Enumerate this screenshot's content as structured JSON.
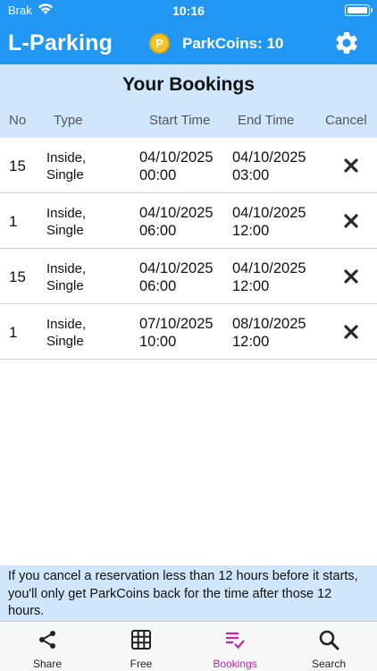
{
  "status_bar": {
    "carrier": "Brak",
    "time": "10:16"
  },
  "app_bar": {
    "title": "L-Parking",
    "coin_symbol": "P",
    "coins_label": "ParkCoins: 10"
  },
  "page": {
    "title": "Your Bookings"
  },
  "table": {
    "headers": {
      "no": "No",
      "type": "Type",
      "start": "Start Time",
      "end": "End Time",
      "cancel": "Cancel"
    },
    "rows": [
      {
        "no": "15",
        "type_line1": "Inside,",
        "type_line2": "Single",
        "start_date": "04/10/2025",
        "start_time": "00:00",
        "end_date": "04/10/2025",
        "end_time": "03:00"
      },
      {
        "no": "1",
        "type_line1": "Inside,",
        "type_line2": "Single",
        "start_date": "04/10/2025",
        "start_time": "06:00",
        "end_date": "04/10/2025",
        "end_time": "12:00"
      },
      {
        "no": "15",
        "type_line1": "Inside,",
        "type_line2": "Single",
        "start_date": "04/10/2025",
        "start_time": "06:00",
        "end_date": "04/10/2025",
        "end_time": "12:00"
      },
      {
        "no": "1",
        "type_line1": "Inside,",
        "type_line2": "Single",
        "start_date": "07/10/2025",
        "start_time": "10:00",
        "end_date": "08/10/2025",
        "end_time": "12:00"
      }
    ]
  },
  "footer_note": "If you cancel a reservation less than 12 hours before it starts, you'll only get ParkCoins back for the time after those 12 hours.",
  "tab_bar": {
    "share": "Share",
    "free": "Free",
    "bookings": "Bookings",
    "search": "Search"
  },
  "colors": {
    "primary": "#2196f3",
    "header_bg": "#cfe6fb",
    "active_tab": "#c026a8",
    "coin": "#f4c430"
  },
  "icons": {
    "cancel": "cancel-x-icon",
    "settings": "gear-icon",
    "share": "share-icon",
    "free": "grid-icon",
    "bookings": "checklist-icon",
    "search": "search-icon"
  }
}
